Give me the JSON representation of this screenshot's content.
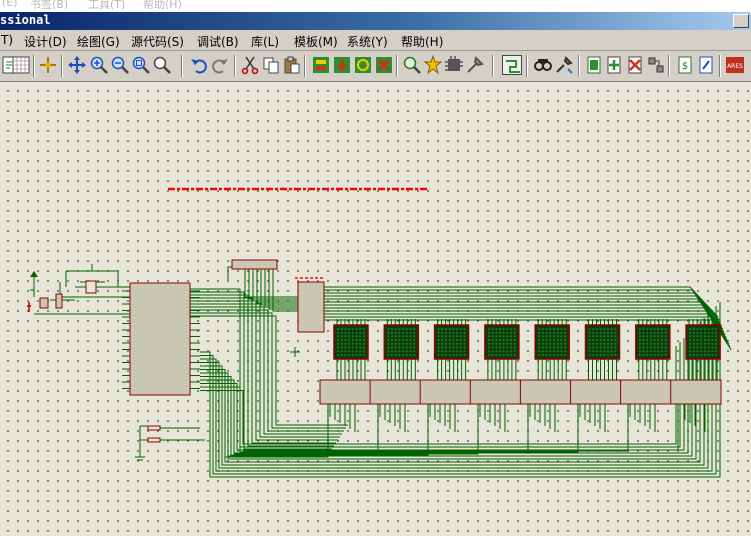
{
  "ghost_menu": [
    "(E)",
    "书签(B)",
    "工具(T)",
    "帮助(H)"
  ],
  "window": {
    "title": "ssional"
  },
  "menu": [
    "T)",
    "设计(D)",
    "绘图(G)",
    "源代码(S)",
    "调试(B)",
    "库(L)",
    "模板(M)",
    "系统(Y)",
    "帮助(H)"
  ],
  "toolbar_icons": [
    "new-sheet-icon",
    "grid-icon",
    "origin-icon",
    "pan-icon",
    "zoom-in-icon",
    "zoom-out-icon",
    "zoom-all-icon",
    "zoom-area-icon",
    "undo-icon",
    "redo-icon",
    "cut-icon",
    "copy-icon",
    "paste-icon",
    "block-copy-icon",
    "block-move-icon",
    "block-rotate-icon",
    "block-delete-icon",
    "pick-device-icon",
    "make-device-icon",
    "decompose-icon",
    "packaging-icon",
    "wire-autorouter-icon",
    "search-icon",
    "property-tool-icon",
    "new-sheet-icon-2",
    "add-sheet-icon",
    "remove-sheet-icon",
    "goto-child-icon",
    "netlist-icon",
    "bill-of-materials-icon",
    "ares-icon"
  ],
  "colors": {
    "titlebar_start": "#0a246a",
    "titlebar_end": "#a6caf0",
    "canvas_bg": "#e7e4d8",
    "component_fill": "#c9c6b2",
    "component_border": "#8b0000",
    "wire": "#006400",
    "matrix_fill": "#0c3b0c",
    "annotation_text": "#ff0000"
  },
  "schematic": {
    "annotation": "",
    "led_matrix_count": 8,
    "mcu_label": "",
    "decoder_label": ""
  }
}
